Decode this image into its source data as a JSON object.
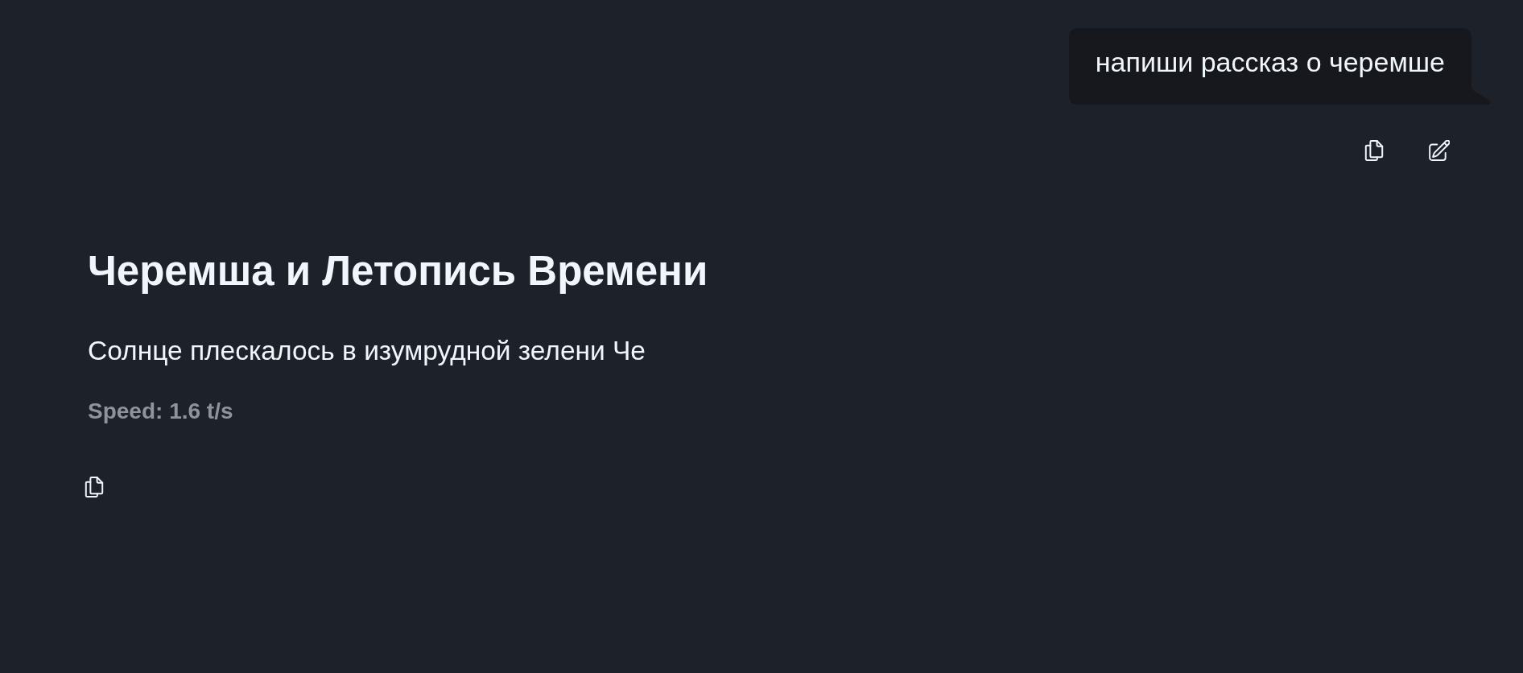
{
  "user_message": {
    "text": "напиши рассказ о черемше",
    "actions": [
      {
        "kind": "copy"
      },
      {
        "kind": "edit"
      }
    ]
  },
  "assistant_message": {
    "title": "Черемша и Летопись Времени",
    "paragraphs": [
      "Солнце плескалось в изумрудной зелени Че"
    ],
    "speed": "Speed: 1.6 t/s",
    "actions": [
      {
        "kind": "copy"
      }
    ]
  }
}
